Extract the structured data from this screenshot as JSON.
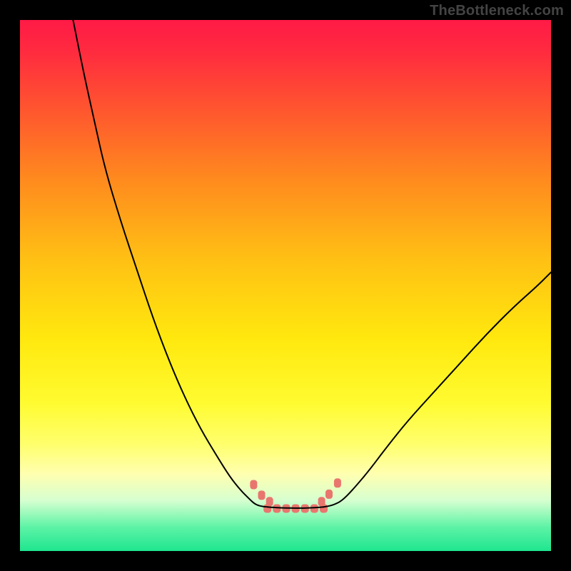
{
  "watermark": "TheBottleneck.com",
  "chart_data": {
    "type": "line",
    "title": "",
    "xlabel": "",
    "ylabel": "",
    "xlim": [
      0,
      100
    ],
    "ylim": [
      0,
      100
    ],
    "gradient_stops": [
      {
        "offset": 0.0,
        "color": "#ff1a46"
      },
      {
        "offset": 0.06,
        "color": "#ff2b3f"
      },
      {
        "offset": 0.18,
        "color": "#ff5a2d"
      },
      {
        "offset": 0.3,
        "color": "#ff8a1e"
      },
      {
        "offset": 0.45,
        "color": "#ffc014"
      },
      {
        "offset": 0.6,
        "color": "#ffe80e"
      },
      {
        "offset": 0.72,
        "color": "#fffb30"
      },
      {
        "offset": 0.8,
        "color": "#ffff6e"
      },
      {
        "offset": 0.855,
        "color": "#ffffb0"
      },
      {
        "offset": 0.905,
        "color": "#d6ffd0"
      },
      {
        "offset": 0.955,
        "color": "#5df3a6"
      },
      {
        "offset": 1.0,
        "color": "#1fe58f"
      }
    ],
    "series": [
      {
        "name": "left-curve",
        "x": [
          10.0,
          12.0,
          14.0,
          16.0,
          19.0,
          22.0,
          25.0,
          28.0,
          31.0,
          34.0,
          37.0,
          39.5,
          41.5,
          42.8,
          43.6,
          44.2,
          44.8,
          45.4,
          46.0,
          46.6
        ],
        "y": [
          100.0,
          90.0,
          81.0,
          72.0,
          62.0,
          53.0,
          44.0,
          36.0,
          29.0,
          23.0,
          18.0,
          14.0,
          11.5,
          10.2,
          9.4,
          8.9,
          8.6,
          8.45,
          8.35,
          8.3
        ]
      },
      {
        "name": "right-curve",
        "x": [
          57.2,
          57.8,
          58.5,
          59.3,
          60.3,
          61.5,
          63.5,
          66.0,
          69.0,
          73.0,
          78.0,
          83.0,
          88.0,
          93.0,
          97.5,
          100.0
        ],
        "y": [
          8.3,
          8.4,
          8.55,
          8.8,
          9.3,
          10.3,
          12.5,
          15.5,
          19.5,
          24.5,
          30.0,
          35.5,
          41.0,
          46.0,
          50.0,
          52.5
        ]
      }
    ],
    "floor_band": {
      "left_x": 46.6,
      "right_x": 57.2,
      "y": 8.0
    },
    "markers_left": [
      {
        "x": 44.0,
        "y": 12.5
      },
      {
        "x": 45.5,
        "y": 10.5
      },
      {
        "x": 47.0,
        "y": 9.3
      }
    ],
    "markers_right": [
      {
        "x": 56.8,
        "y": 9.3
      },
      {
        "x": 58.2,
        "y": 10.7
      },
      {
        "x": 59.8,
        "y": 12.8
      }
    ],
    "markers_floor_count": 7,
    "marker_color": "#e9766e",
    "curve_color": "#000000"
  }
}
